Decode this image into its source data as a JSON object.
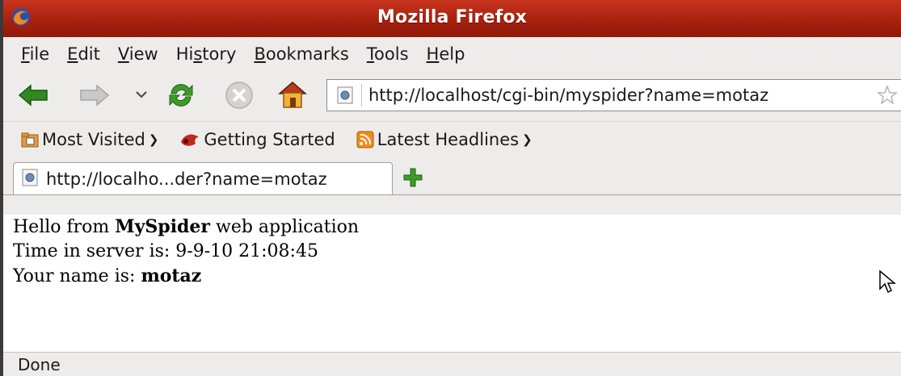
{
  "window": {
    "title": "Mozilla Firefox"
  },
  "menubar": {
    "items": [
      {
        "key": "F",
        "rest": "ile"
      },
      {
        "key": "E",
        "rest": "dit"
      },
      {
        "key": "V",
        "rest": "iew"
      },
      {
        "pre": "Hi",
        "key": "s",
        "rest": "tory"
      },
      {
        "key": "B",
        "rest": "ookmarks"
      },
      {
        "key": "T",
        "rest": "ools"
      },
      {
        "key": "H",
        "rest": "elp"
      }
    ]
  },
  "navbar": {
    "url": "http://localhost/cgi-bin/myspider?name=motaz",
    "icons": [
      "back-arrow-icon",
      "forward-arrow-icon",
      "history-dropdown-icon",
      "reload-icon",
      "stop-icon",
      "home-icon"
    ]
  },
  "bookmarks": {
    "most_visited": "Most Visited",
    "getting_started": "Getting Started",
    "latest_headlines": "Latest Headlines"
  },
  "tabs": [
    {
      "label": "http://localho...der?name=motaz"
    }
  ],
  "content": {
    "line1_prefix": "Hello from ",
    "line1_bold": "MySpider",
    "line1_suffix": " web application",
    "line2": "Time in server is: 9-9-10 21:08:45",
    "line3_prefix": "Your name is: ",
    "line3_bold": "motaz"
  },
  "status": {
    "text": "Done"
  },
  "colors": {
    "titlebar": "#a5200e",
    "back_arrow": "#2f8a1f",
    "reload": "#3f9a2a",
    "rss": "#f28c1a"
  }
}
